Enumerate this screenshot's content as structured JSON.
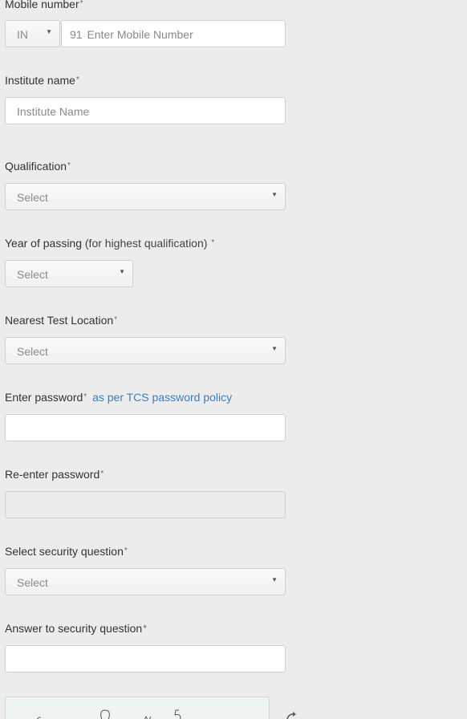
{
  "mobile": {
    "label": "Mobile number",
    "required": "*",
    "country_code": "IN",
    "prefix": "91",
    "placeholder": "Enter Mobile Number"
  },
  "institute": {
    "label": "Institute name",
    "required": "*",
    "placeholder": "Institute Name"
  },
  "qualification": {
    "label": "Qualification",
    "required": "*",
    "selected": "Select"
  },
  "year_of_passing": {
    "label": "Year of passing",
    "note": "(for highest qualification)",
    "required": "*",
    "selected": "Select"
  },
  "test_location": {
    "label": "Nearest Test Location",
    "required": "*",
    "selected": "Select"
  },
  "password": {
    "label": "Enter password",
    "required": "*",
    "policy_link": "as per TCS password policy",
    "value": ""
  },
  "reenter_password": {
    "label": "Re-enter password",
    "required": "*",
    "value": ""
  },
  "security_question": {
    "label": "Select security question",
    "required": "*",
    "selected": "Select"
  },
  "security_answer": {
    "label": "Answer to security question",
    "required": "*",
    "value": ""
  },
  "icons": {
    "dropdown": "chevron-down-icon",
    "refresh": "refresh-icon"
  },
  "colors": {
    "page_background": "#ececec",
    "link": "#3b7dbf",
    "field_border": "#cfcfcf"
  }
}
